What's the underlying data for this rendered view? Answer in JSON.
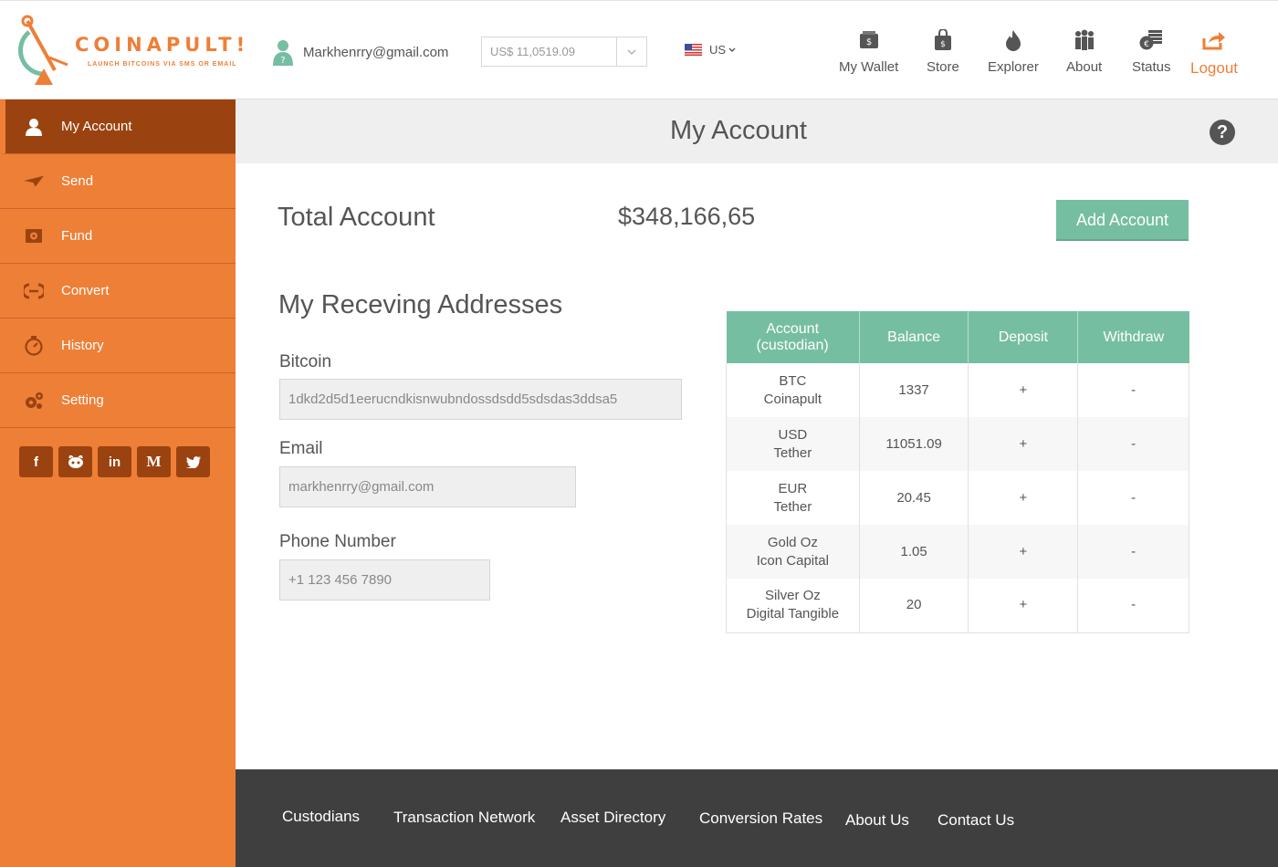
{
  "header": {
    "logo_text": "COINAPULT!",
    "logo_tagline": "LAUNCH BITCOINS VIA SMS OR EMAIL",
    "user_email": "Markhenrry@gmail.com",
    "balance_display": "US$ 11,0519.09",
    "language": "US",
    "nav": [
      {
        "label": "My Wallet",
        "icon": "wallet-icon"
      },
      {
        "label": "Store",
        "icon": "shopping-bag-icon"
      },
      {
        "label": "Explorer",
        "icon": "flame-icon"
      },
      {
        "label": "About",
        "icon": "people-icon"
      },
      {
        "label": "Status",
        "icon": "coins-icon"
      },
      {
        "label": "Logout",
        "icon": "logout-icon"
      }
    ]
  },
  "sidebar": {
    "items": [
      {
        "label": "My Account",
        "icon": "user-icon",
        "active": true
      },
      {
        "label": "Send",
        "icon": "paper-plane-icon"
      },
      {
        "label": "Fund",
        "icon": "safe-icon"
      },
      {
        "label": "Convert",
        "icon": "convert-icon"
      },
      {
        "label": "History",
        "icon": "stopwatch-icon"
      },
      {
        "label": "Setting",
        "icon": "gears-icon"
      }
    ],
    "social": [
      {
        "name": "facebook-icon",
        "glyph": "f"
      },
      {
        "name": "github-icon",
        "glyph": "⌾"
      },
      {
        "name": "linkedin-icon",
        "glyph": "in"
      },
      {
        "name": "medium-icon",
        "glyph": "M"
      },
      {
        "name": "twitter-icon",
        "glyph": "🐦"
      }
    ]
  },
  "page": {
    "title": "My Account",
    "help": "?"
  },
  "account": {
    "total_label": "Total Account",
    "total_value": "$348,166,65",
    "add_button": "Add Account",
    "addresses_title": "My Receving Addresses",
    "bitcoin_label": "Bitcoin",
    "bitcoin_value": "1dkd2d5d1eerucndkisnwubndossdsdd5sdsdas3ddsa5",
    "email_label": "Email",
    "email_value": "markhenrry@gmail.com",
    "phone_label": "Phone Number",
    "phone_value": "+1 123 456 7890"
  },
  "table": {
    "headers": [
      "Account (custodian)",
      "Balance",
      "Deposit",
      "Withdraw"
    ],
    "rows": [
      {
        "account": "BTC",
        "custodian": "Coinapult",
        "balance": "1337",
        "deposit": "+",
        "withdraw": "-"
      },
      {
        "account": "USD",
        "custodian": "Tether",
        "balance": "11051.09",
        "deposit": "+",
        "withdraw": "-"
      },
      {
        "account": "EUR",
        "custodian": "Tether",
        "balance": "20.45",
        "deposit": "+",
        "withdraw": "-"
      },
      {
        "account": "Gold Oz",
        "custodian": "Icon Capital",
        "balance": "1.05",
        "deposit": "+",
        "withdraw": "-"
      },
      {
        "account": "Silver Oz",
        "custodian": "Digital Tangible",
        "balance": "20",
        "deposit": "+",
        "withdraw": "-"
      }
    ]
  },
  "footer": {
    "links": [
      "Custodians",
      "Transaction Network",
      "Asset Directory",
      "Conversion Rates",
      "About Us",
      "Contact Us"
    ]
  },
  "colors": {
    "brand_orange": "#ee7f37",
    "sidebar_active": "#9b4310",
    "accent_green": "#76bea2",
    "footer_bg": "#3f3f3f"
  }
}
